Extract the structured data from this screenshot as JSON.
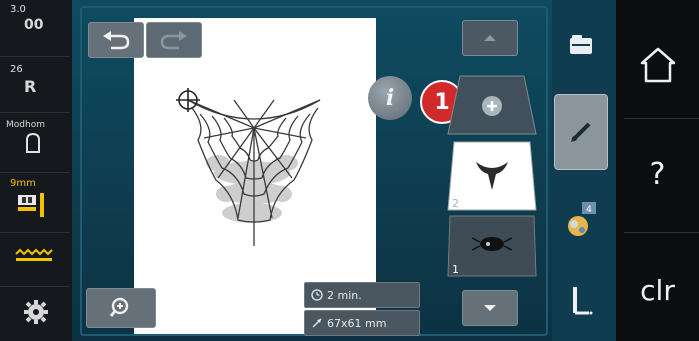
{
  "left_bar": {
    "speed": {
      "label": "3.0",
      "sub": "00"
    },
    "stitch": {
      "label": "26",
      "sub": "R"
    },
    "mode": {
      "label": "Modhom"
    },
    "hoop": {
      "label": "9mm"
    },
    "feed_dog_icon": "feed-dog-icon",
    "settings_icon": "gear-icon"
  },
  "toolbar": {
    "undo_icon": "undo-icon",
    "redo_icon": "redo-icon",
    "zoom_icon": "zoom-icon",
    "info_label": "i",
    "badge_label": "1"
  },
  "layers": {
    "add_icon": "add-layer-icon",
    "layer2_label": "2",
    "layer1_label": "1",
    "up_icon": "arrow-up-icon",
    "down_icon": "arrow-down-icon"
  },
  "status": {
    "time": "2 min.",
    "size": "67x61 mm"
  },
  "side_panel": {
    "items": [
      "folder-icon",
      "pencil-icon",
      "color-icon",
      "stitch-start-icon"
    ]
  },
  "right_bar": {
    "home_icon": "home-icon",
    "help_label": "?",
    "clr_label": "clr"
  },
  "colors": {
    "panel_bg": "#0f3c4e",
    "badge": "#d22a2a",
    "canvas": "#ffffff"
  }
}
